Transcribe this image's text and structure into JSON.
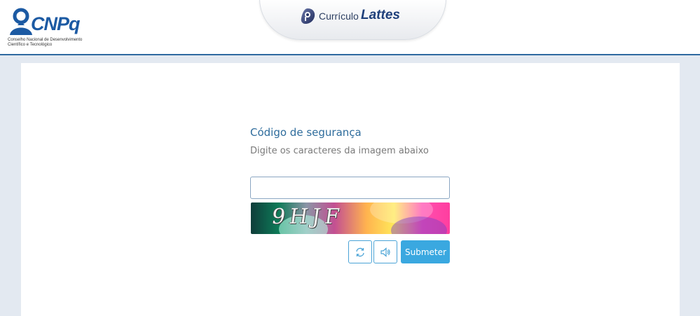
{
  "header": {
    "logo_text": "CNPq",
    "logo_subtitle": "Conselho Nacional de Desenvolvimento Científico e Tecnológico",
    "tab_prefix": "Currículo",
    "tab_title": "Lattes"
  },
  "form": {
    "title": "Código de segurança",
    "subtitle": "Digite os caracteres da imagem abaixo",
    "input_value": "",
    "captcha_text": "9HJF",
    "refresh_icon": "refresh-icon",
    "audio_icon": "speaker-icon",
    "submit_label": "Submeter"
  },
  "colors": {
    "accent": "#3aa8e0",
    "title": "#2e6c9c",
    "header_rule": "#2f6aa0",
    "background": "#e3e9f1"
  }
}
